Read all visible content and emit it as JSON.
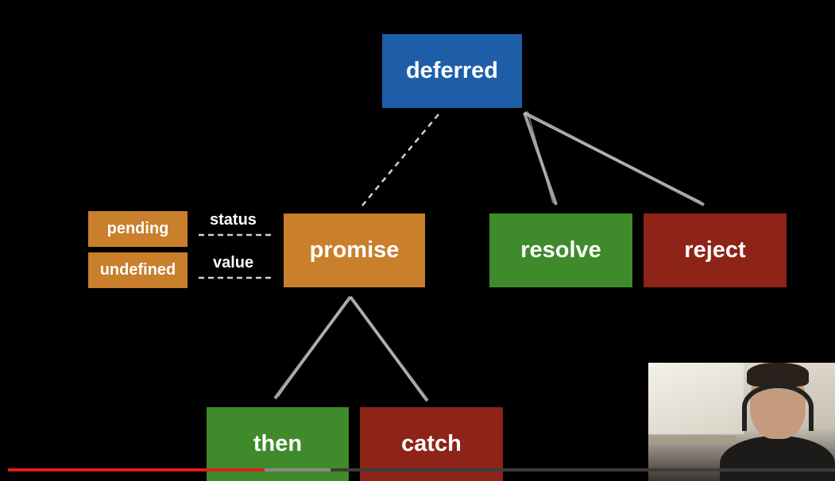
{
  "diagram": {
    "nodes": {
      "deferred": "deferred",
      "promise": "promise",
      "resolve": "resolve",
      "reject": "reject",
      "then": "then",
      "catch": "catch",
      "pending": "pending",
      "undefined": "undefined"
    },
    "edge_labels": {
      "status": "status",
      "value": "value"
    },
    "colors": {
      "blue": "#1e5ea8",
      "orange": "#c97f2c",
      "green": "#3f8a2b",
      "red": "#8e2318"
    }
  },
  "video": {
    "played_fraction": 0.31,
    "buffered_fraction": 0.39
  }
}
